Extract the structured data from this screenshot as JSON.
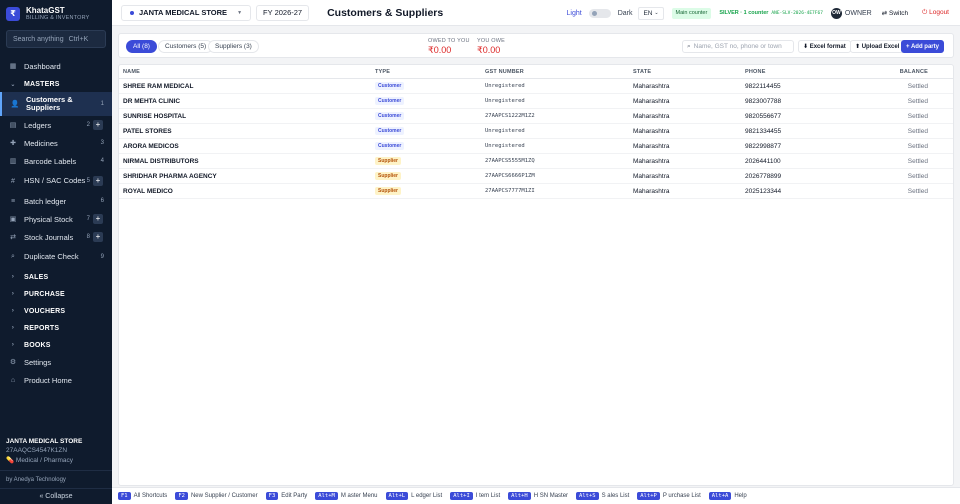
{
  "app": {
    "brand": "KhataGST",
    "brand_sub": "BILLING & INVENTORY",
    "brand_logo": "₹"
  },
  "sidebar": {
    "search_placeholder": "Search anything",
    "search_shortcut": "Ctrl+K",
    "items": [
      {
        "label": "Dashboard",
        "icon": "grid-icon",
        "glyph": "▦"
      },
      {
        "label": "MASTERS",
        "section": true,
        "glyph": "⌄"
      },
      {
        "label": "Customers & Suppliers",
        "icon": "users-icon",
        "glyph": "👤",
        "count": "1",
        "active": true
      },
      {
        "label": "Ledgers",
        "icon": "book-icon",
        "glyph": "▤",
        "count": "2",
        "plus": true
      },
      {
        "label": "Medicines",
        "icon": "pill-icon",
        "glyph": "✚",
        "count": "3"
      },
      {
        "label": "Barcode Labels",
        "icon": "barcode-icon",
        "glyph": "▥",
        "count": "4"
      },
      {
        "label": "HSN / SAC Codes",
        "icon": "hash-icon",
        "glyph": "#",
        "count": "5",
        "plus": true
      },
      {
        "label": "Batch ledger",
        "icon": "layers-icon",
        "glyph": "≡",
        "count": "6"
      },
      {
        "label": "Physical Stock",
        "icon": "box-icon",
        "glyph": "▣",
        "count": "7",
        "plus": true
      },
      {
        "label": "Stock Journals",
        "icon": "arrows-icon",
        "glyph": "⇄",
        "count": "8",
        "plus": true
      },
      {
        "label": "Duplicate Check",
        "icon": "search-icon",
        "glyph": "⌕",
        "count": "9"
      },
      {
        "label": "SALES",
        "section": true,
        "glyph": "›"
      },
      {
        "label": "PURCHASE",
        "section": true,
        "glyph": "›"
      },
      {
        "label": "VOUCHERS",
        "section": true,
        "glyph": "›"
      },
      {
        "label": "REPORTS",
        "section": true,
        "glyph": "›"
      },
      {
        "label": "BOOKS",
        "section": true,
        "glyph": "›"
      },
      {
        "label": "Settings",
        "icon": "gear-icon",
        "glyph": "⚙"
      },
      {
        "label": "Product Home",
        "icon": "home-icon",
        "glyph": "⌂"
      }
    ],
    "store_name": "JANTA MEDICAL STORE",
    "store_gstin": "27AAQCS4547K1ZN",
    "store_type": "Medical / Pharmacy",
    "by_line": "by Anedya Technology",
    "collapse_label": "« Collapse"
  },
  "topbar": {
    "store": "JANTA MEDICAL STORE",
    "fy": "FY 2026-27",
    "title": "Customers & Suppliers",
    "theme_light": "Light",
    "theme_dark": "Dark",
    "lang": "EN",
    "counter": "Main counter",
    "plan": "SILVER · 1 counter",
    "plan_id": "ANE-SLV-2026-4E7F67",
    "owner_initials": "OW",
    "owner": "OWNER",
    "switch": "⇄ Switch",
    "logout": "⏻ Logout"
  },
  "filters": {
    "tabs": [
      "All (8)",
      "Customers (5)",
      "Suppliers (3)"
    ],
    "owed_label": "OWED TO YOU",
    "owed_value": "₹0.00",
    "owe_label": "YOU OWE",
    "owe_value": "₹0.00",
    "search_placeholder": "Name, GST no, phone or town",
    "excel_format": "⬇ Excel format",
    "upload_excel": "⬆ Upload Excel",
    "add_party": "+ Add party"
  },
  "table": {
    "headers": [
      "NAME",
      "TYPE",
      "GST NUMBER",
      "STATE",
      "PHONE",
      "BALANCE"
    ],
    "rows": [
      {
        "name": "SHREE RAM MEDICAL",
        "type": "Customer",
        "gst": "Unregistered",
        "state": "Maharashtra",
        "phone": "9822114455",
        "balance": "Settled"
      },
      {
        "name": "DR MEHTA CLINIC",
        "type": "Customer",
        "gst": "Unregistered",
        "state": "Maharashtra",
        "phone": "9823007788",
        "balance": "Settled"
      },
      {
        "name": "SUNRISE HOSPITAL",
        "type": "Customer",
        "gst": "27AAPCS1222M1Z2",
        "state": "Maharashtra",
        "phone": "9820556677",
        "balance": "Settled"
      },
      {
        "name": "PATEL STORES",
        "type": "Customer",
        "gst": "Unregistered",
        "state": "Maharashtra",
        "phone": "9821334455",
        "balance": "Settled"
      },
      {
        "name": "ARORA MEDICOS",
        "type": "Customer",
        "gst": "Unregistered",
        "state": "Maharashtra",
        "phone": "9822998877",
        "balance": "Settled"
      },
      {
        "name": "NIRMAL DISTRIBUTORS",
        "type": "Supplier",
        "gst": "27AAPCS5555M1ZQ",
        "state": "Maharashtra",
        "phone": "2026441100",
        "balance": "Settled"
      },
      {
        "name": "SHRIDHAR PHARMA AGENCY",
        "type": "Supplier",
        "gst": "27AAPCS6666P1ZM",
        "state": "Maharashtra",
        "phone": "2026778899",
        "balance": "Settled"
      },
      {
        "name": "ROYAL MEDICO",
        "type": "Supplier",
        "gst": "27AAPCS7777M1ZI",
        "state": "Maharashtra",
        "phone": "2025123344",
        "balance": "Settled"
      }
    ]
  },
  "shortcuts": [
    {
      "key": "F1",
      "label": "All Shortcuts"
    },
    {
      "key": "F2",
      "label": "New Supplier / Customer"
    },
    {
      "key": "F3",
      "label": "Edit Party"
    },
    {
      "key": "Alt+M",
      "label": "M aster Menu"
    },
    {
      "key": "Alt+L",
      "label": "L edger List"
    },
    {
      "key": "Alt+I",
      "label": "I tem List"
    },
    {
      "key": "Alt+H",
      "label": "H SN Master"
    },
    {
      "key": "Alt+S",
      "label": "S ales List"
    },
    {
      "key": "Alt+P",
      "label": "P urchase List"
    },
    {
      "key": "Alt+A",
      "label": "Help"
    }
  ]
}
